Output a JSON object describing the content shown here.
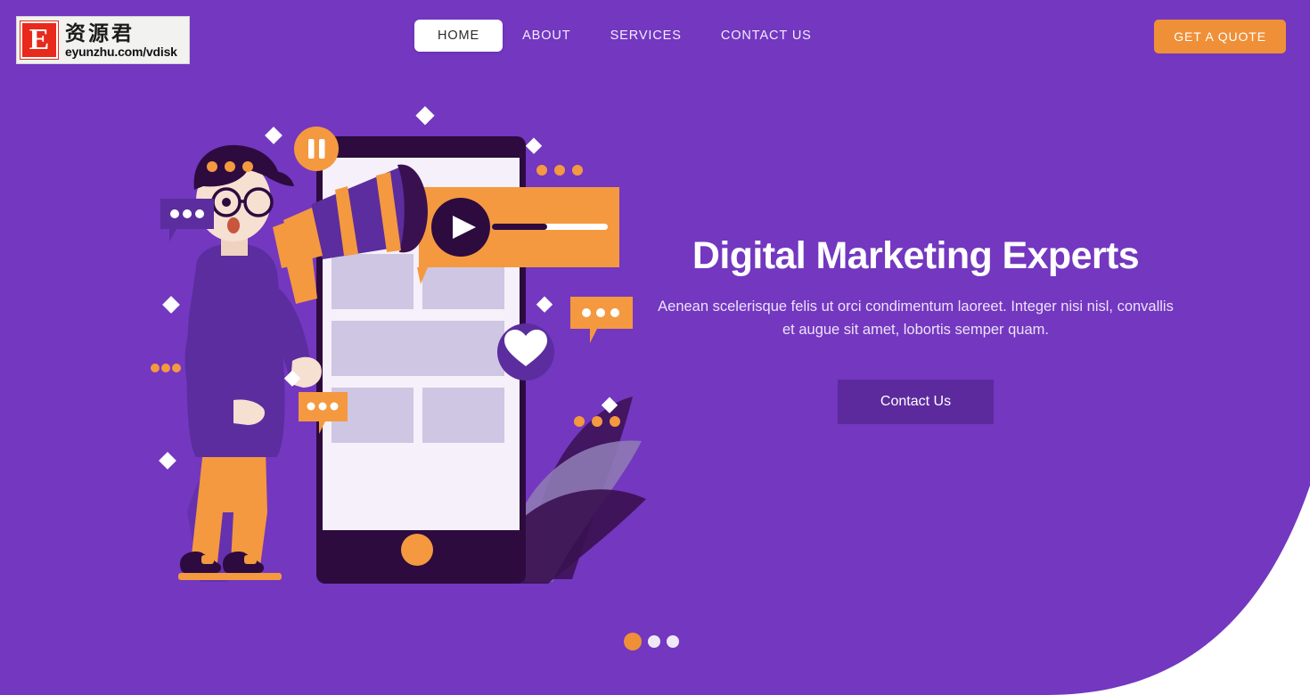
{
  "page": {
    "background_color": "#7337c0",
    "accent_color": "#ef9038",
    "text_color": "#ffffff",
    "curve_color": "#ffffff"
  },
  "logo": {
    "mark_letter": "E",
    "chinese_name": "资源君",
    "url": "eyunzhu.com/vdisk"
  },
  "nav": {
    "items": [
      {
        "label": "HOME",
        "active": true
      },
      {
        "label": "ABOUT",
        "active": false
      },
      {
        "label": "SERVICES",
        "active": false
      },
      {
        "label": "CONTACT US",
        "active": false
      }
    ],
    "cta_label": "GET A QUOTE"
  },
  "hero": {
    "title": "Digital Marketing Experts",
    "subtitle": "Aenean scelerisque felis ut orci condimentum laoreet. Integer nisi nisl, convallis et augue sit amet, lobortis semper quam.",
    "button_label": "Contact Us"
  },
  "carousel": {
    "slide_count": 3,
    "active_index": 1,
    "dot_labels": [
      "slide-1",
      "slide-2",
      "slide-3"
    ]
  },
  "illustration": {
    "description": "Man with glasses holding a megaphone next to a smartphone mockup",
    "badges": [
      "pause-badge",
      "play-button",
      "heart-badge"
    ],
    "chat_bubbles": 4,
    "colors": {
      "dark_purple": "#2d0b3f",
      "mid_purple": "#5b2d9e",
      "light_purple": "#8e6bc4",
      "orange": "#f4993f",
      "screen": "#f5f0fa",
      "placeholder": "#cfc6e3",
      "skin": "#f6e0d2"
    }
  }
}
